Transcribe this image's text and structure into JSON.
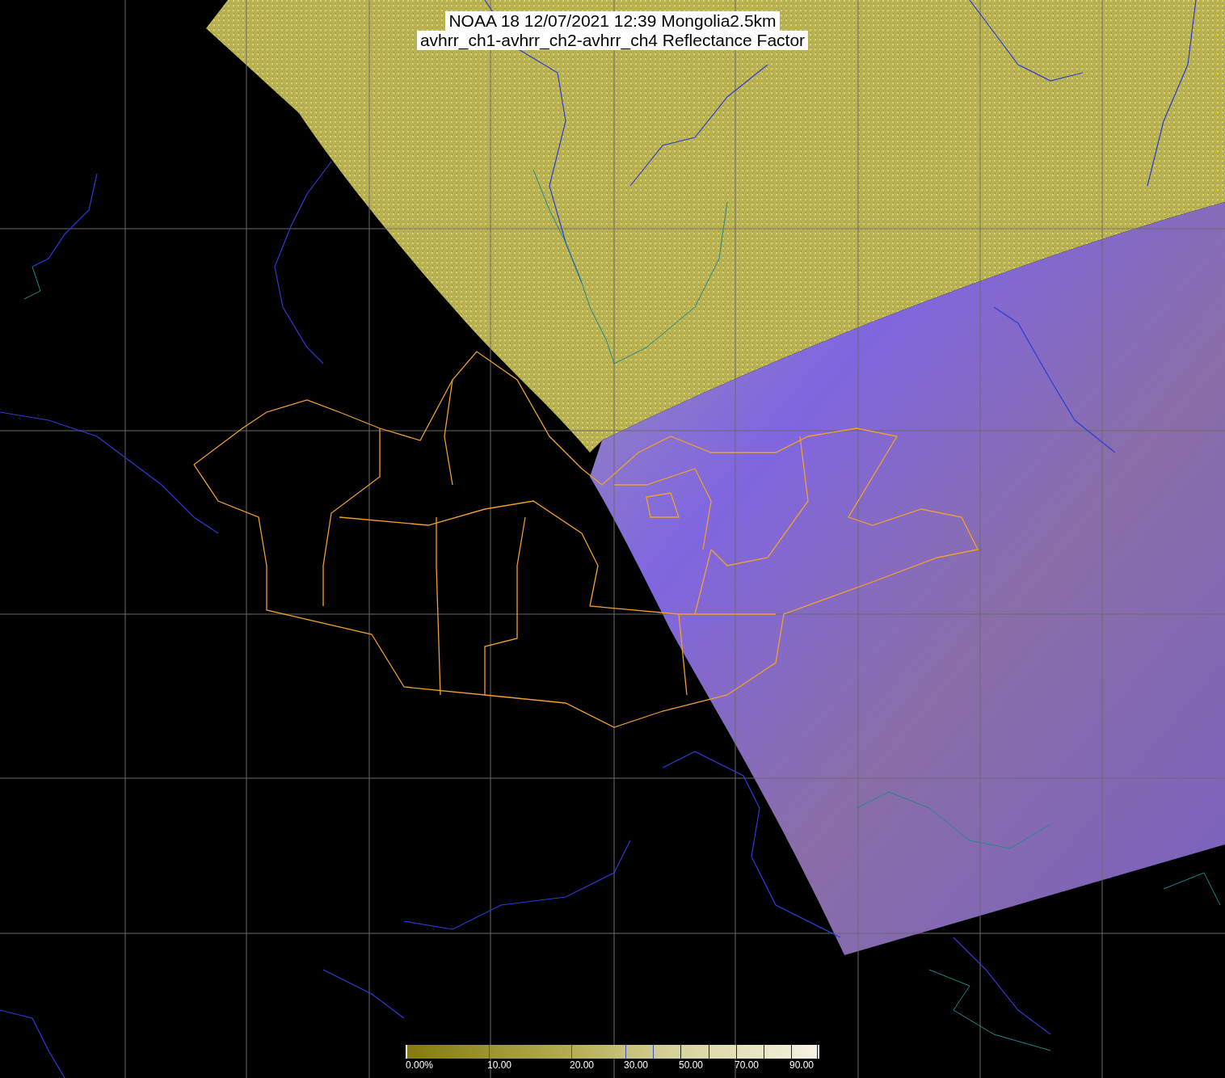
{
  "title": {
    "lines": [
      "NOAA 18 12/07/2021 12:39 Mongolia2.5km",
      "avhrr_ch1-avhrr_ch2-avhrr_ch4 Reflectance Factor"
    ]
  },
  "colorbar": {
    "tick_labels": [
      "0.00%",
      "10.00",
      "20.00",
      "30.00",
      "50.00",
      "70.00",
      "90.00"
    ]
  }
}
